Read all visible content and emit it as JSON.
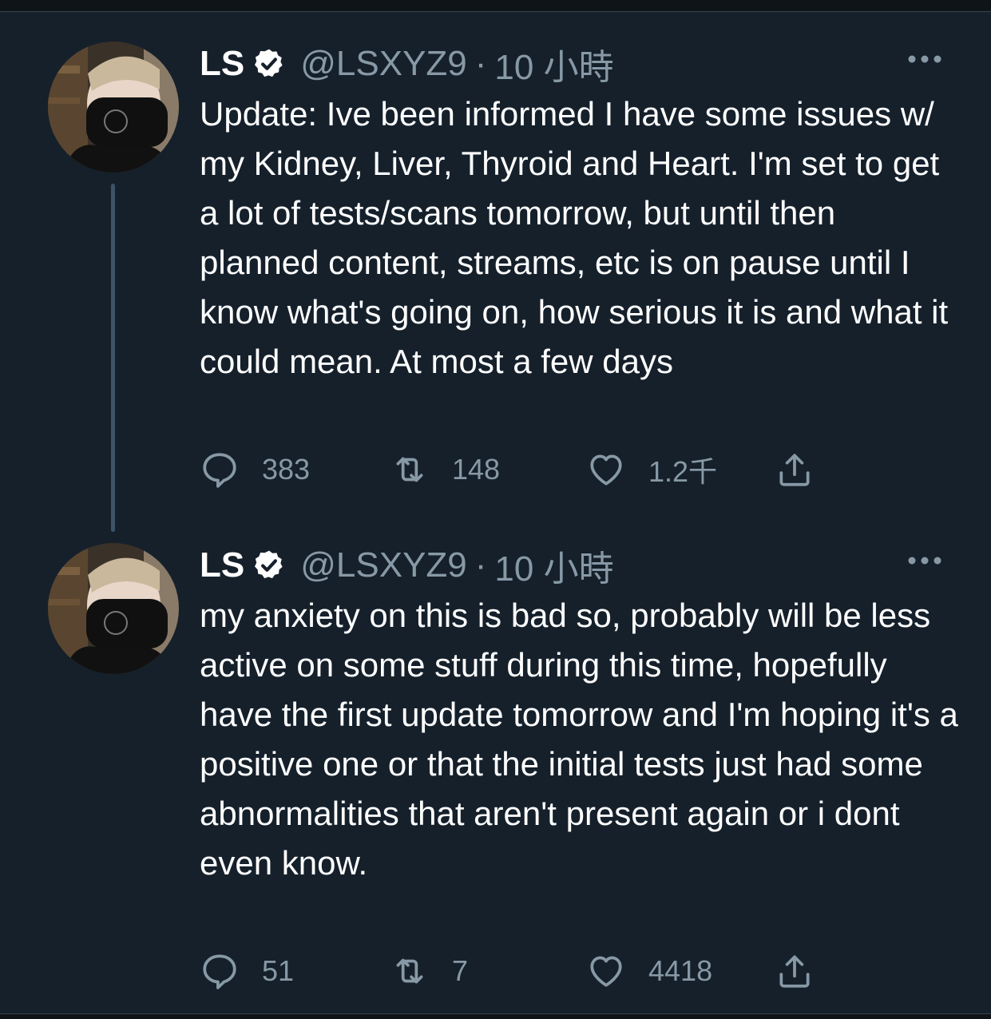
{
  "tweets": [
    {
      "display_name": "LS",
      "handle": "@LSXYZ9",
      "separator": "·",
      "timestamp": "10 小時",
      "text": "Update: Ive been informed I have some issues w/ my Kidney, Liver, Thyroid and Heart. I'm set to get a lot of tests/scans tomorrow, but until then planned content, streams, etc is on pause until I know what's going on, how serious it is and what it could mean. At most a few days",
      "replies": "383",
      "retweets": "148",
      "likes": "1.2千"
    },
    {
      "display_name": "LS",
      "handle": "@LSXYZ9",
      "separator": "·",
      "timestamp": "10 小時",
      "text": "my anxiety on this is bad so, probably will be less active on some stuff during this time, hopefully have the first update tomorrow and I'm hoping it's a positive one or that the initial tests just had some abnormalities that aren't present again or i dont even know.",
      "replies": "51",
      "retweets": "7",
      "likes": "4418"
    }
  ],
  "colors": {
    "background": "#15202b",
    "text_primary": "#ffffff",
    "text_secondary": "#8899a6",
    "thread_line": "#3d5466"
  },
  "icons": {
    "verified": "verified-badge-icon",
    "more": "more-options-icon",
    "reply": "reply-icon",
    "retweet": "retweet-icon",
    "like": "heart-icon",
    "share": "share-icon"
  }
}
